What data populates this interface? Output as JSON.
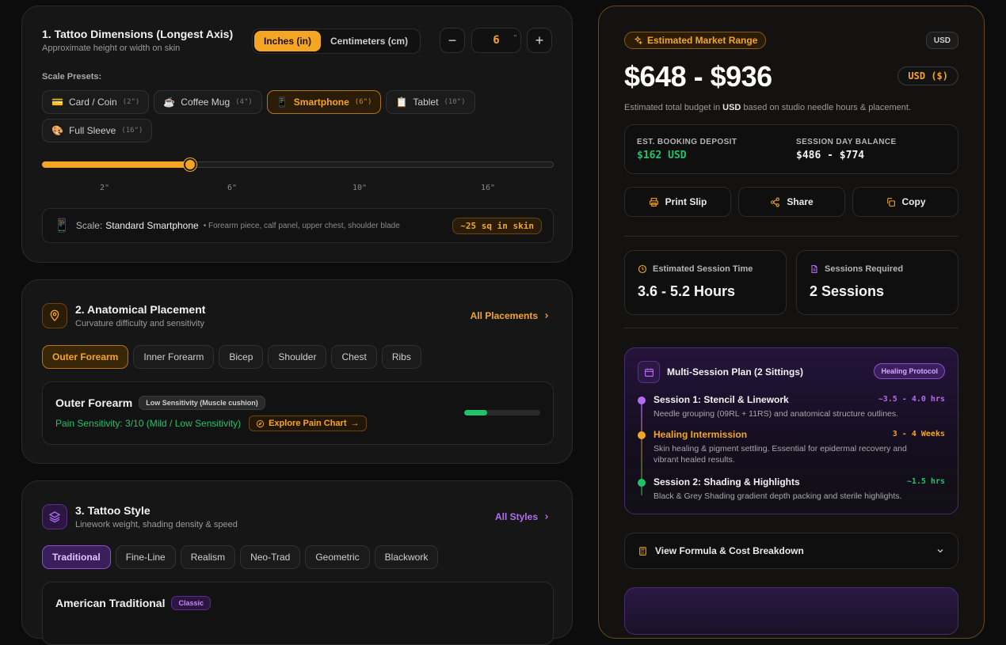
{
  "dimensions": {
    "title": "1. Tattoo Dimensions (Longest Axis)",
    "subtitle": "Approximate height or width on skin",
    "units": [
      "Inches (in)",
      "Centimeters (cm)"
    ],
    "size_value": "6",
    "size_unit": "\"",
    "minus": "−",
    "plus": "+",
    "presets_label": "Scale Presets:",
    "presets": [
      {
        "icon": "💳",
        "label": "Card / Coin",
        "size": "(2\")"
      },
      {
        "icon": "☕",
        "label": "Coffee Mug",
        "size": "(4\")"
      },
      {
        "icon": "📱",
        "label": "Smartphone",
        "size": "(6\")"
      },
      {
        "icon": "📋",
        "label": "Tablet",
        "size": "(10\")"
      },
      {
        "icon": "🎨",
        "label": "Full Sleeve",
        "size": "(16\")"
      }
    ],
    "slider_fraction": 0.29,
    "ticks": [
      "2\"",
      "6\"",
      "10\"",
      "16\""
    ],
    "scale_label": "Scale:",
    "scale_name": "Standard Smartphone",
    "scale_desc": "• Forearm piece, calf panel, upper chest, shoulder blade",
    "scale_badge": "~25 sq in skin"
  },
  "placement": {
    "title": "2. Anatomical Placement",
    "subtitle": "Curvature difficulty and sensitivity",
    "all_link": "All Placements",
    "chips": [
      "Outer Forearm",
      "Inner Forearm",
      "Bicep",
      "Shoulder",
      "Chest",
      "Ribs"
    ],
    "detail_name": "Outer Forearm",
    "detail_badge": "Low Sensitivity (Muscle cushion)",
    "pain_text": "Pain Sensitivity: 3/10 (Mild / Low Sensitivity)",
    "pain_button": "Explore Pain Chart",
    "pain_fraction": 0.3
  },
  "style": {
    "title": "3. Tattoo Style",
    "subtitle": "Linework weight, shading density & speed",
    "all_link": "All Styles",
    "chips": [
      "Traditional",
      "Fine-Line",
      "Realism",
      "Neo-Trad",
      "Geometric",
      "Blackwork"
    ],
    "detail_name": "American Traditional",
    "detail_badge": "Classic"
  },
  "estimate": {
    "badge": "Estimated Market Range",
    "currency_tag": "USD",
    "price": "$648 - $936",
    "currency_select": "USD ($)",
    "note_pre": "Estimated total budget in ",
    "note_bold": "USD",
    "note_post": " based on studio needle hours & placement.",
    "deposit_label": "EST. BOOKING DEPOSIT",
    "deposit_value": "$162 USD",
    "balance_label": "SESSION DAY BALANCE",
    "balance_value": "$486 - $774",
    "actions": [
      "Print Slip",
      "Share",
      "Copy"
    ],
    "time_label": "Estimated Session Time",
    "time_value": "3.6 - 5.2 Hours",
    "sessions_label": "Sessions Required",
    "sessions_value": "2 Sessions"
  },
  "plan": {
    "title": "Multi-Session Plan (2 Sittings)",
    "badge": "Healing Protocol",
    "steps": [
      {
        "title": "Session 1: Stencil & Linework",
        "time": "~3.5 - 4.0 hrs",
        "desc": "Needle grouping (09RL + 11RS) and anatomical structure outlines.",
        "color": "#b36df0"
      },
      {
        "title": "Healing Intermission",
        "time": "3 - 4 Weeks",
        "desc": "Skin healing & pigment settling. Essential for epidermal recovery and vibrant healed results.",
        "color": "#f5a524"
      },
      {
        "title": "Session 2: Shading & Highlights",
        "time": "~1.5 hrs",
        "desc": "Black & Grey Shading gradient depth packing and sterile highlights.",
        "color": "#20c36b"
      }
    ]
  },
  "formula": {
    "label": "View Formula & Cost Breakdown"
  }
}
